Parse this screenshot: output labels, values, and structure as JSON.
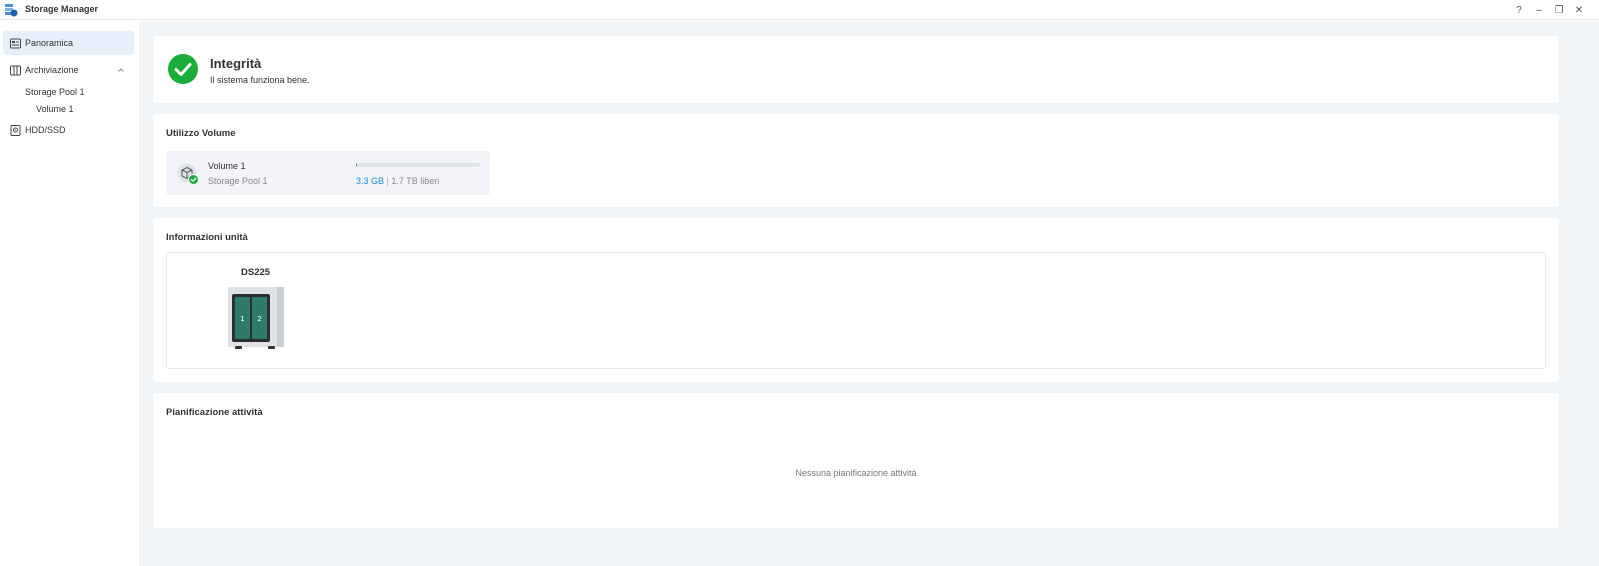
{
  "window": {
    "title": "Storage Manager",
    "controls": {
      "help": "?",
      "minimize": "–",
      "restore": "❐",
      "close": "✕"
    }
  },
  "sidebar": {
    "items": [
      {
        "label": "Panoramica",
        "icon": "overview-icon",
        "active": true
      },
      {
        "label": "Archiviazione",
        "icon": "storage-icon",
        "expanded": true
      },
      {
        "label": "HDD/SSD",
        "icon": "drive-icon"
      }
    ],
    "subitems": [
      {
        "label": "Storage Pool 1"
      },
      {
        "label": "Volume 1"
      }
    ]
  },
  "health": {
    "title": "Integrità",
    "description": "Il sistema funziona bene.",
    "status_color": "#1aad3a"
  },
  "volume_usage": {
    "title": "Utilizzo Volume",
    "volume": {
      "name": "Volume 1",
      "pool": "Storage Pool 1",
      "used": "3.3 GB",
      "separator": "|",
      "free": "1.7 TB liberi",
      "used_fraction": 0.002
    }
  },
  "unit_info": {
    "title": "Informazioni unità",
    "model": "DS225",
    "bays": [
      "1",
      "2"
    ]
  },
  "schedule": {
    "title": "Pianificazione attività",
    "empty": "Nessuna pianificazione attività"
  },
  "colors": {
    "accent": "#1f88d9",
    "success": "#1aad3a",
    "active_nav": "#e6f0fb",
    "main_bg": "#f2f5f8"
  }
}
